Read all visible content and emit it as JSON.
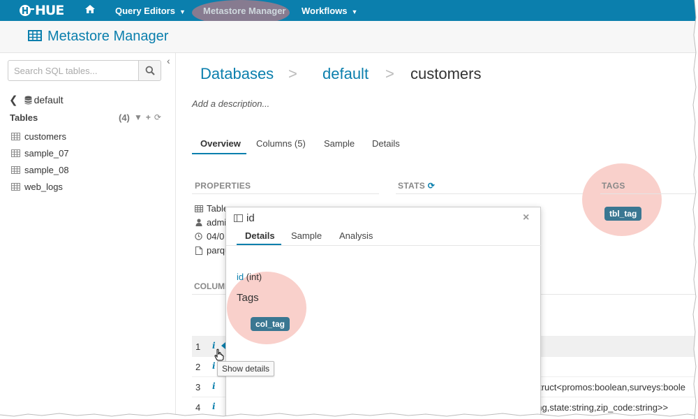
{
  "nav": {
    "logo": "HUE",
    "items": [
      {
        "label": "Query Editors",
        "has_caret": true
      },
      {
        "label": "Metastore Manager",
        "has_caret": false
      },
      {
        "label": "Workflows",
        "has_caret": true
      }
    ],
    "home_icon": "home-icon",
    "colors": {
      "bar": "#0B7FAD",
      "highlight": "#EE7878"
    }
  },
  "header": {
    "title": "Metastore Manager",
    "icon": "table-grid-icon"
  },
  "sidebar": {
    "search_placeholder": "Search SQL tables...",
    "database": "default",
    "tables_label": "Tables",
    "tables_count": "(4)",
    "tables": [
      "customers",
      "sample_07",
      "sample_08",
      "web_logs"
    ]
  },
  "breadcrumb": {
    "databases": "Databases",
    "sep": ">",
    "database": "default",
    "table": "customers"
  },
  "description_placeholder": "Add a description...",
  "tabs": [
    "Overview",
    "Columns (5)",
    "Sample",
    "Details"
  ],
  "sections": {
    "properties": "PROPERTIES",
    "stats": "STATS",
    "tags": "TAGS",
    "columns": "COLUMNS"
  },
  "properties": [
    "Table",
    "admin",
    "04/0",
    "parqu"
  ],
  "table_tag": "tbl_tag",
  "column_rows": [
    {
      "num": "1",
      "info": "i",
      "text": ""
    },
    {
      "num": "2",
      "info": "i",
      "text": ""
    },
    {
      "num": "3",
      "info": "i",
      "text": ":struct<promos:boolean,surveys:boole"
    },
    {
      "num": "4",
      "info": "i",
      "text": "ring,state:string,zip_code:string>>"
    }
  ],
  "tooltip": "Show details",
  "popover": {
    "title": "id",
    "tabs": [
      "Details",
      "Sample",
      "Analysis"
    ],
    "column_name": "id",
    "column_type": "(int)",
    "tags_label": "Tags",
    "column_tag": "col_tag",
    "close_glyph": "×"
  }
}
